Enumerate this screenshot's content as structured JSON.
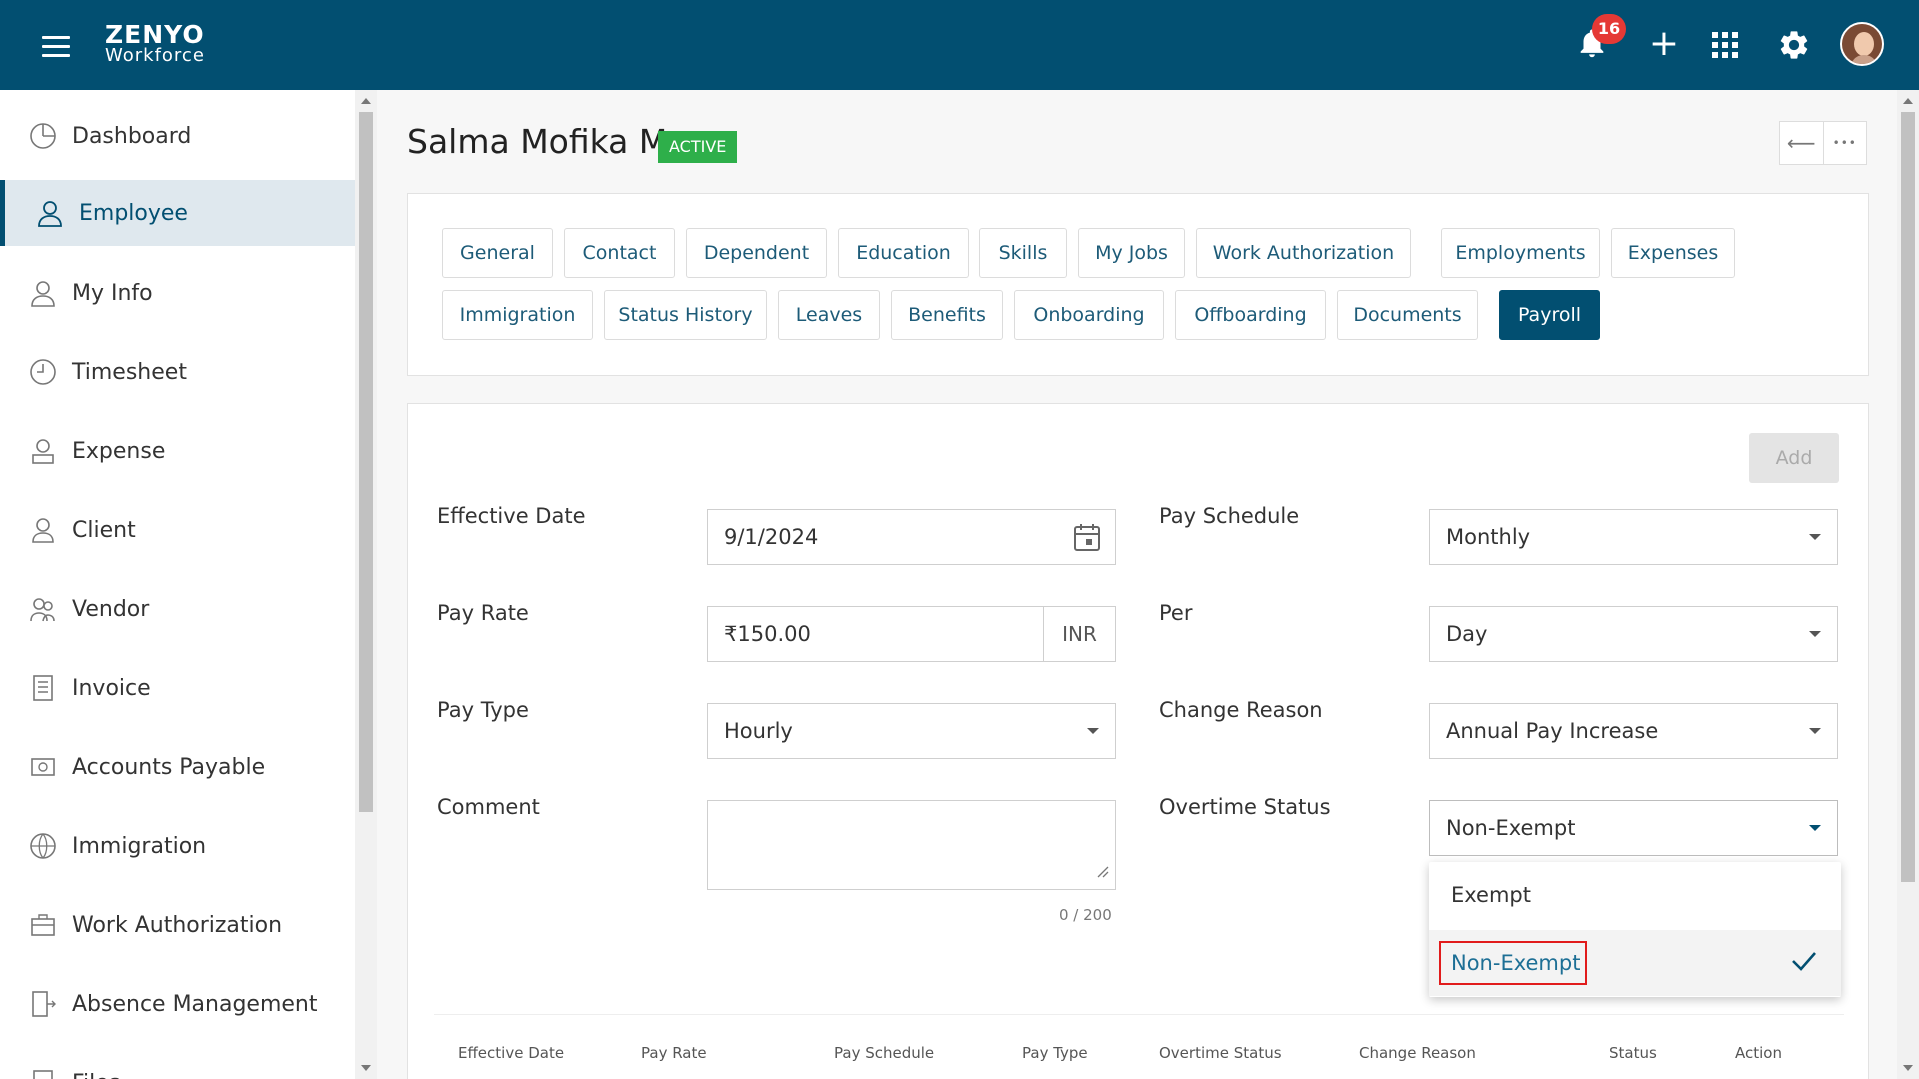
{
  "topbar": {
    "logo_line1": "ZENYO",
    "logo_line2": "Workforce",
    "notification_count": "16",
    "add_symbol": "+"
  },
  "sidebar": {
    "items": [
      {
        "label": "Dashboard",
        "icon": "dashboard-icon"
      },
      {
        "label": "Employee",
        "icon": "employee-icon",
        "active": true
      },
      {
        "label": "My Info",
        "icon": "my-info-icon"
      },
      {
        "label": "Timesheet",
        "icon": "clock-icon"
      },
      {
        "label": "Expense",
        "icon": "expense-icon"
      },
      {
        "label": "Client",
        "icon": "client-icon"
      },
      {
        "label": "Vendor",
        "icon": "vendor-icon"
      },
      {
        "label": "Invoice",
        "icon": "invoice-icon"
      },
      {
        "label": "Accounts Payable",
        "icon": "accounts-payable-icon"
      },
      {
        "label": "Immigration",
        "icon": "globe-icon"
      },
      {
        "label": "Work Authorization",
        "icon": "briefcase-icon"
      },
      {
        "label": "Absence Management",
        "icon": "absence-icon"
      },
      {
        "label": "Files",
        "icon": "files-icon"
      }
    ]
  },
  "header": {
    "employee_name": "Salma Mofika M",
    "status": "ACTIVE",
    "back_symbol": "⟵",
    "more_symbol": "•••"
  },
  "tabs": {
    "row1": [
      "General",
      "Contact",
      "Dependent",
      "Education",
      "Skills",
      "My Jobs",
      "Work Authorization",
      "Employments",
      "Expenses"
    ],
    "row2": [
      "Immigration",
      "Status History",
      "Leaves",
      "Benefits",
      "Onboarding",
      "Offboarding",
      "Documents",
      "Payroll"
    ],
    "active": "Payroll"
  },
  "form": {
    "add_label": "Add",
    "effective_date_label": "Effective Date",
    "effective_date_value": "9/1/2024",
    "pay_rate_label": "Pay Rate",
    "pay_rate_value": "₹150.00",
    "pay_rate_currency": "INR",
    "pay_type_label": "Pay Type",
    "pay_type_value": "Hourly",
    "comment_label": "Comment",
    "comment_value": "",
    "comment_counter": "0 / 200",
    "pay_schedule_label": "Pay Schedule",
    "pay_schedule_value": "Monthly",
    "per_label": "Per",
    "per_value": "Day",
    "change_reason_label": "Change Reason",
    "change_reason_value": "Annual Pay Increase",
    "overtime_status_label": "Overtime Status",
    "overtime_status_value": "Non-Exempt",
    "overtime_options": [
      "Exempt",
      "Non-Exempt"
    ],
    "overtime_selected": "Non-Exempt"
  },
  "table": {
    "headers": [
      "Effective Date",
      "Pay Rate",
      "Pay Schedule",
      "Pay Type",
      "Overtime Status",
      "Change Reason",
      "Status",
      "Action"
    ]
  },
  "colors": {
    "brand": "#024f71",
    "active_badge": "#2eaf4a",
    "notification": "#e53935",
    "highlight": "#e11b1b"
  }
}
